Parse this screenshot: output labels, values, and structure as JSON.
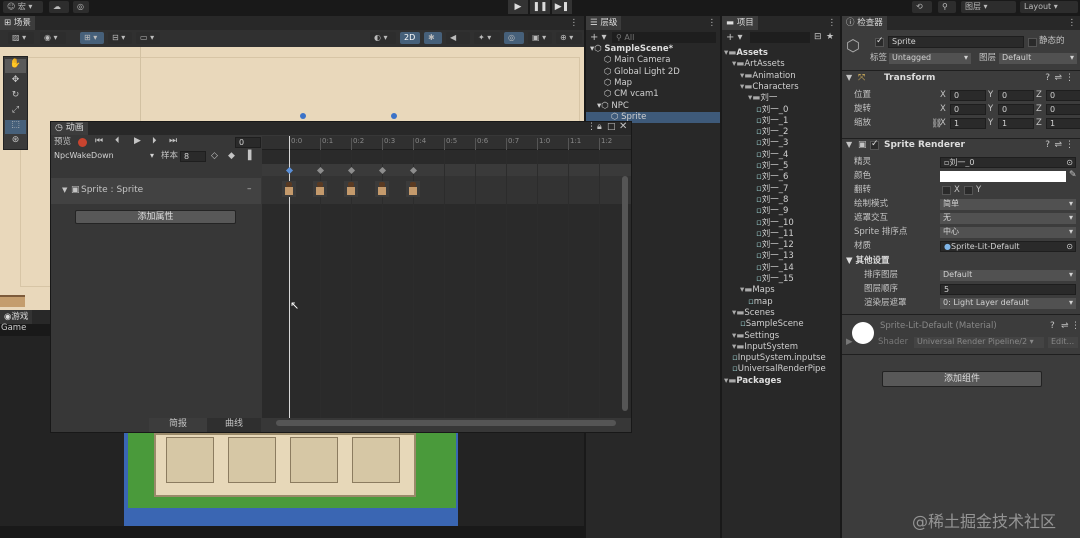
{
  "topbar": {
    "account": "☺ 宏 ▾",
    "layers": "图层",
    "layout": "Layout",
    "play_controls": [
      "▶",
      "❚❚",
      "▶❚"
    ]
  },
  "scene": {
    "tab": "场景",
    "mode_2d": "2D"
  },
  "game": {
    "tab": "游戏",
    "label": "Game"
  },
  "hierarchy": {
    "tab": "层级",
    "search_placeholder": "All",
    "items": [
      {
        "label": "SampleScene*",
        "indent": 0,
        "bold": true
      },
      {
        "label": "Main Camera",
        "indent": 2
      },
      {
        "label": "Global Light 2D",
        "indent": 2
      },
      {
        "label": "Map",
        "indent": 2
      },
      {
        "label": "CM vcam1",
        "indent": 2
      },
      {
        "label": "NPC",
        "indent": 1
      },
      {
        "label": "Sprite",
        "indent": 3,
        "selected": true
      }
    ]
  },
  "project": {
    "tab": "项目",
    "items": [
      {
        "label": "Assets",
        "indent": 0,
        "bold": true
      },
      {
        "label": "ArtAssets",
        "indent": 1
      },
      {
        "label": "Animation",
        "indent": 2
      },
      {
        "label": "Characters",
        "indent": 2
      },
      {
        "label": "刘一",
        "indent": 3
      },
      {
        "label": "刘一_0",
        "indent": 4
      },
      {
        "label": "刘一_1",
        "indent": 4
      },
      {
        "label": "刘一_2",
        "indent": 4
      },
      {
        "label": "刘一_3",
        "indent": 4
      },
      {
        "label": "刘一_4",
        "indent": 4
      },
      {
        "label": "刘一_5",
        "indent": 4
      },
      {
        "label": "刘一_6",
        "indent": 4
      },
      {
        "label": "刘一_7",
        "indent": 4
      },
      {
        "label": "刘一_8",
        "indent": 4
      },
      {
        "label": "刘一_9",
        "indent": 4
      },
      {
        "label": "刘一_10",
        "indent": 4
      },
      {
        "label": "刘一_11",
        "indent": 4
      },
      {
        "label": "刘一_12",
        "indent": 4
      },
      {
        "label": "刘一_13",
        "indent": 4
      },
      {
        "label": "刘一_14",
        "indent": 4
      },
      {
        "label": "刘一_15",
        "indent": 4
      },
      {
        "label": "Maps",
        "indent": 2
      },
      {
        "label": "map",
        "indent": 3
      },
      {
        "label": "Scenes",
        "indent": 1
      },
      {
        "label": "SampleScene",
        "indent": 2
      },
      {
        "label": "Settings",
        "indent": 1
      },
      {
        "label": "InputSystem",
        "indent": 1
      },
      {
        "label": "InputSystem.inputse",
        "indent": 1
      },
      {
        "label": "UniversalRenderPipe",
        "indent": 1
      },
      {
        "label": "Packages",
        "indent": 0,
        "bold": true
      }
    ]
  },
  "inspector": {
    "tab": "检查器",
    "name": "Sprite",
    "static_label": "静态的",
    "tag_label": "标签",
    "tag_value": "Untagged",
    "layer_label": "图层",
    "layer_value": "Default",
    "transform": {
      "title": "Transform",
      "rows": [
        {
          "label": "位置",
          "x": "0",
          "y": "0",
          "z": "0"
        },
        {
          "label": "旋转",
          "x": "0",
          "y": "0",
          "z": "0"
        },
        {
          "label": "缩放",
          "x": "1",
          "y": "1",
          "z": "1"
        }
      ],
      "x_label": "X",
      "y_label": "Y",
      "z_label": "Z"
    },
    "sprite_renderer": {
      "title": "Sprite Renderer",
      "sprite_label": "精灵",
      "sprite_value": "刘一_0",
      "color_label": "颜色",
      "flip_label": "翻转",
      "flip_x": "X",
      "flip_y": "Y",
      "draw_mode_label": "绘制模式",
      "draw_mode_value": "简单",
      "mask_label": "遮罩交互",
      "mask_value": "无",
      "pivot_label": "Sprite 排序点",
      "pivot_value": "中心",
      "material_label": "材质",
      "material_value": "Sprite-Lit-Default",
      "other_label": "其他设置",
      "sorting_layer_label": "排序图层",
      "sorting_layer_value": "Default",
      "order_label": "图层顺序",
      "order_value": "5",
      "render_layer_label": "渲染层遮罩",
      "render_layer_value": "0: Light Layer default"
    },
    "material": {
      "name": "Sprite-Lit-Default (Material)",
      "shader_label": "Shader",
      "shader_value": "Universal Render Pipeline/2",
      "edit": "Edit..."
    },
    "add_component": "添加组件"
  },
  "animation": {
    "tab": "动画",
    "preview": "预览",
    "frame": "0",
    "clip": "NpcWakeDown",
    "samples_label": "样本",
    "samples_value": "8",
    "property": "Sprite : Sprite",
    "add_property": "添加属性",
    "tab_dopesheet": "简报",
    "tab_curves": "曲线",
    "ruler": [
      "0:0",
      "0:1",
      "0:2",
      "0:3",
      "0:4",
      "0:5",
      "0:6",
      "0:7",
      "1:0",
      "1:1",
      "1:2"
    ],
    "keyframes": [
      0,
      1,
      2,
      3,
      4
    ]
  },
  "watermark": "@稀土掘金技术社区"
}
